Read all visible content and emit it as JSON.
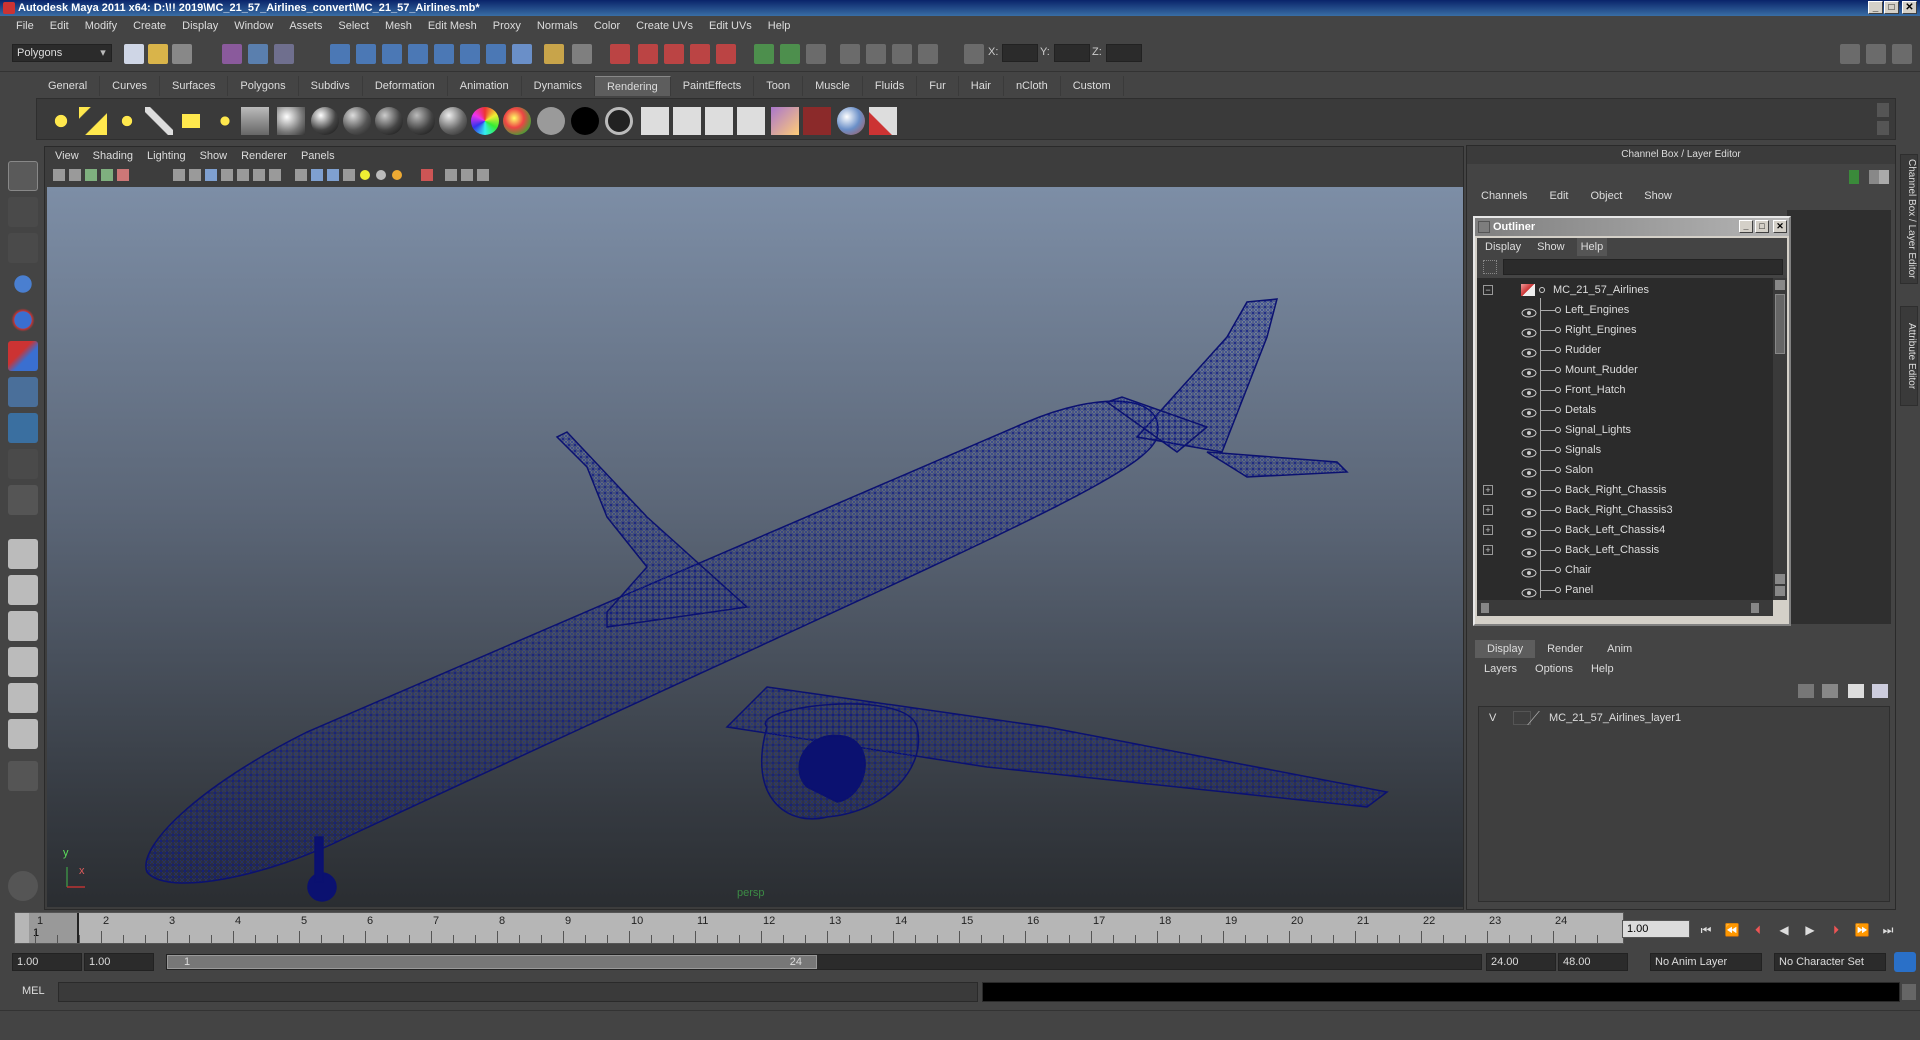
{
  "window": {
    "title": "Autodesk Maya 2011 x64: D:\\!! 2019\\MC_21_57_Airlines_convert\\MC_21_57_Airlines.mb*",
    "min": "_",
    "max": "□",
    "close": "✕"
  },
  "menu": [
    "File",
    "Edit",
    "Modify",
    "Create",
    "Display",
    "Window",
    "Assets",
    "Select",
    "Mesh",
    "Edit Mesh",
    "Proxy",
    "Normals",
    "Color",
    "Create UVs",
    "Edit UVs",
    "Help"
  ],
  "status": {
    "mode": "Polygons",
    "x_label": "X:",
    "y_label": "Y:",
    "z_label": "Z:"
  },
  "shelf_tabs": [
    "General",
    "Curves",
    "Surfaces",
    "Polygons",
    "Subdivs",
    "Deformation",
    "Animation",
    "Dynamics",
    "Rendering",
    "PaintEffects",
    "Toon",
    "Muscle",
    "Fluids",
    "Fur",
    "Hair",
    "nCloth",
    "Custom"
  ],
  "active_shelf_tab": "Rendering",
  "viewport": {
    "menu": [
      "View",
      "Shading",
      "Lighting",
      "Show",
      "Renderer",
      "Panels"
    ],
    "camera": "persp",
    "axis_y": "y",
    "axis_x": "x",
    "wire_color": "#0b1170"
  },
  "channel_box": {
    "title": "Channel Box / Layer Editor",
    "menu": [
      "Channels",
      "Edit",
      "Object",
      "Show"
    ]
  },
  "outliner": {
    "title": "Outliner",
    "menu": [
      "Display",
      "Show",
      "Help"
    ],
    "root": "MC_21_57_Airlines",
    "items": [
      {
        "label": "Left_Engines",
        "expandable": false
      },
      {
        "label": "Right_Engines",
        "expandable": false
      },
      {
        "label": "Rudder",
        "expandable": false
      },
      {
        "label": "Mount_Rudder",
        "expandable": false
      },
      {
        "label": "Front_Hatch",
        "expandable": false
      },
      {
        "label": "Detals",
        "expandable": false
      },
      {
        "label": "Signal_Lights",
        "expandable": false
      },
      {
        "label": "Signals",
        "expandable": false
      },
      {
        "label": "Salon",
        "expandable": false
      },
      {
        "label": "Back_Right_Chassis",
        "expandable": true
      },
      {
        "label": "Back_Right_Chassis3",
        "expandable": true
      },
      {
        "label": "Back_Left_Chassis4",
        "expandable": true
      },
      {
        "label": "Back_Left_Chassis",
        "expandable": true
      },
      {
        "label": "Chair",
        "expandable": false
      },
      {
        "label": "Panel",
        "expandable": false
      }
    ]
  },
  "layer_editor": {
    "tabs": [
      "Display",
      "Render",
      "Anim"
    ],
    "menu": [
      "Layers",
      "Options",
      "Help"
    ],
    "layers": [
      {
        "visible": "V",
        "name": "MC_21_57_Airlines_layer1"
      }
    ]
  },
  "side_tabs": [
    "Channel Box / Layer Editor",
    "Attribute Editor"
  ],
  "timeline": {
    "ticks": [
      "1",
      "2",
      "3",
      "4",
      "5",
      "6",
      "7",
      "8",
      "9",
      "10",
      "11",
      "12",
      "13",
      "14",
      "15",
      "16",
      "17",
      "18",
      "19",
      "20",
      "21",
      "22",
      "23",
      "24"
    ],
    "current_marker": "1",
    "current_frame": "1.00"
  },
  "range": {
    "start": "1.00",
    "playback_start": "1.00",
    "handle_start": "1",
    "handle_end": "24",
    "playback_end": "24.00",
    "end": "48.00",
    "anim_layer": "No Anim Layer",
    "char_set": "No Character Set"
  },
  "command": {
    "label": "MEL"
  }
}
